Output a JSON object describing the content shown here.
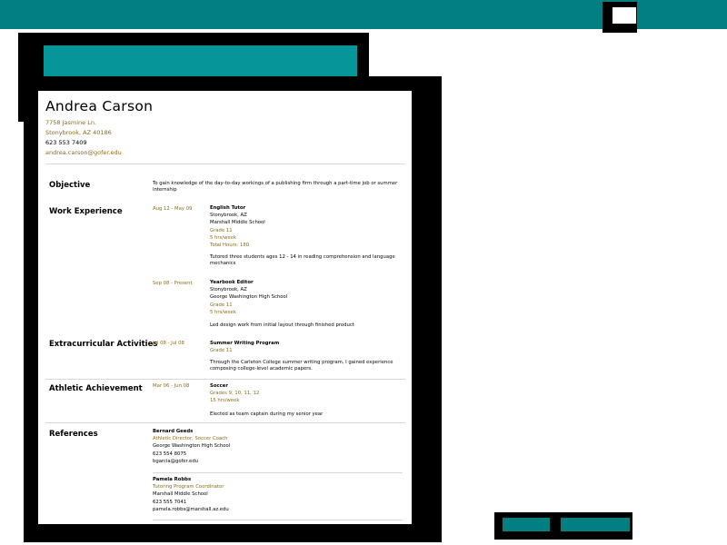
{
  "resume": {
    "name": "Andrea Carson",
    "address_line1": "7758 Jasmine Ln.",
    "address_line2": "Stonybrook, AZ 40186",
    "phone": "623 553 7409",
    "email": "andrea.carson@gofer.edu",
    "objective": {
      "title": "Objective",
      "text": "To gain knowledge of the day-to-day workings of a publishing firm through a part-time job or summer internship"
    },
    "work": {
      "title": "Work Experience",
      "items": [
        {
          "dates": "Aug 12 - May 09",
          "role": "English Tutor",
          "lines": [
            "Stonybrook, AZ",
            "Marshall Middle School",
            "Grade 11",
            "5 hrs/week",
            "Total Hours: 180"
          ],
          "desc": "Tutored three students ages 12 - 14 in reading comprehension and language mechanics"
        },
        {
          "dates": "Sep 08 - Present",
          "role": "Yearbook Editor",
          "lines": [
            "Stonybrook, AZ",
            "George Washington High School",
            "Grade 11",
            "5 hrs/week"
          ],
          "desc": "Led design work from initial layout through finished product"
        }
      ]
    },
    "extracurricular": {
      "title": "Extracurricular Activities",
      "dates": "Jul 08 - Jul 08",
      "role": "Summer Writing Program",
      "lines": [
        "Grade 11"
      ],
      "desc": "Through the Carleton College summer writing program, I gained experience composing college-level academic papers."
    },
    "athletic": {
      "title": "Athletic Achievement",
      "dates": "Mar 06 - Jun 08",
      "role": "Soccer",
      "lines": [
        "Grades 9, 10, 11, 12",
        "15 hrs/week"
      ],
      "desc": "Elected as team captain during my senior year"
    },
    "references": {
      "title": "References",
      "items": [
        {
          "name": "Bernard Geeds",
          "lines": [
            "Athletic Director, Soccer Coach",
            "George Washington High School",
            "623 554 8075",
            "bgarcia@gofer.edu"
          ]
        },
        {
          "name": "Pamela Robbs",
          "lines": [
            "Tutoring Program Coordinator",
            "Marshall Middle School",
            "623 555 7041",
            "pamela.robbs@marshall.az.edu"
          ]
        }
      ]
    }
  }
}
